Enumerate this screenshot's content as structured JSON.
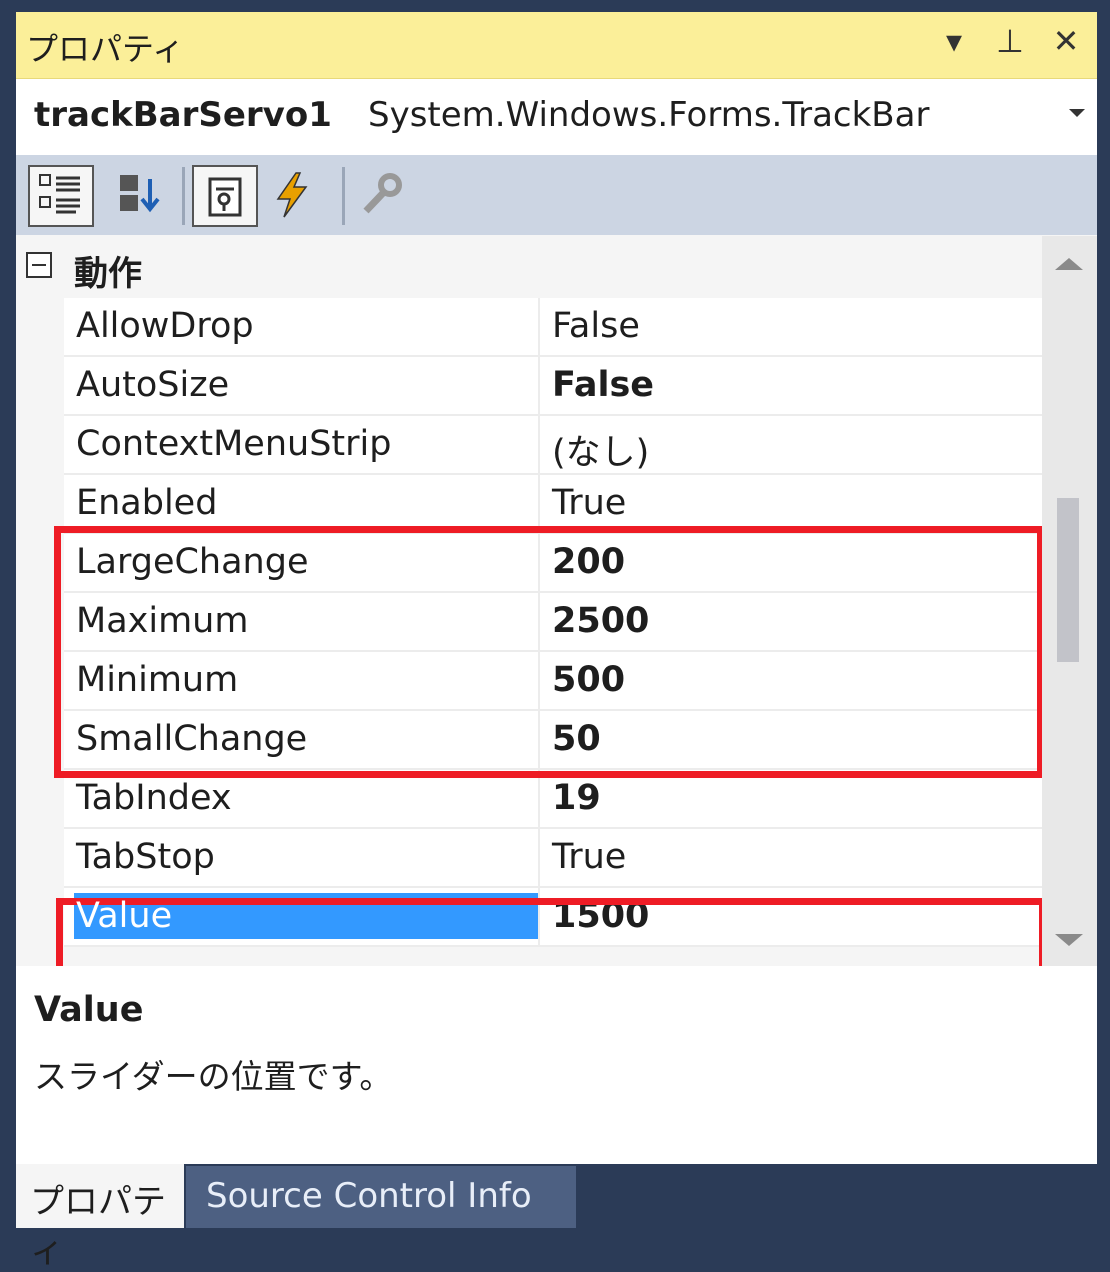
{
  "titlebar": {
    "title": "プロパティ",
    "icons": [
      "chevron-down-icon",
      "pin-icon",
      "close-icon"
    ],
    "glyphs": {
      "dropdown": "▾",
      "pin": "⊥",
      "close": "✕"
    }
  },
  "object": {
    "name": "trackBarServo1",
    "type": "System.Windows.Forms.TrackBar"
  },
  "toolbar": {
    "buttons": [
      "categorized-icon",
      "alphabetical-icon",
      "properties-icon",
      "events-icon",
      "property-pages-icon"
    ]
  },
  "category": {
    "label": "動作",
    "expanded": true
  },
  "properties": [
    {
      "name": "AllowDrop",
      "value": "False",
      "bold": false
    },
    {
      "name": "AutoSize",
      "value": "False",
      "bold": true
    },
    {
      "name": "ContextMenuStrip",
      "value": "(なし)",
      "bold": false
    },
    {
      "name": "Enabled",
      "value": "True",
      "bold": false
    },
    {
      "name": "LargeChange",
      "value": "200",
      "bold": true
    },
    {
      "name": "Maximum",
      "value": "2500",
      "bold": true
    },
    {
      "name": "Minimum",
      "value": "500",
      "bold": true
    },
    {
      "name": "SmallChange",
      "value": "50",
      "bold": true
    },
    {
      "name": "TabIndex",
      "value": "19",
      "bold": true
    },
    {
      "name": "TabStop",
      "value": "True",
      "bold": false
    },
    {
      "name": "Value",
      "value": "1500",
      "bold": true,
      "selected": true
    }
  ],
  "description": {
    "title": "Value",
    "text": "スライダーの位置です。"
  },
  "tabs": [
    {
      "label": "プロパティ",
      "active": true
    },
    {
      "label": "Source Control Info",
      "active": false
    }
  ],
  "colors": {
    "highlight": "#ee1c25",
    "selection": "#3399ff",
    "titlebar": "#fbef99",
    "background": "#2b3b57"
  }
}
